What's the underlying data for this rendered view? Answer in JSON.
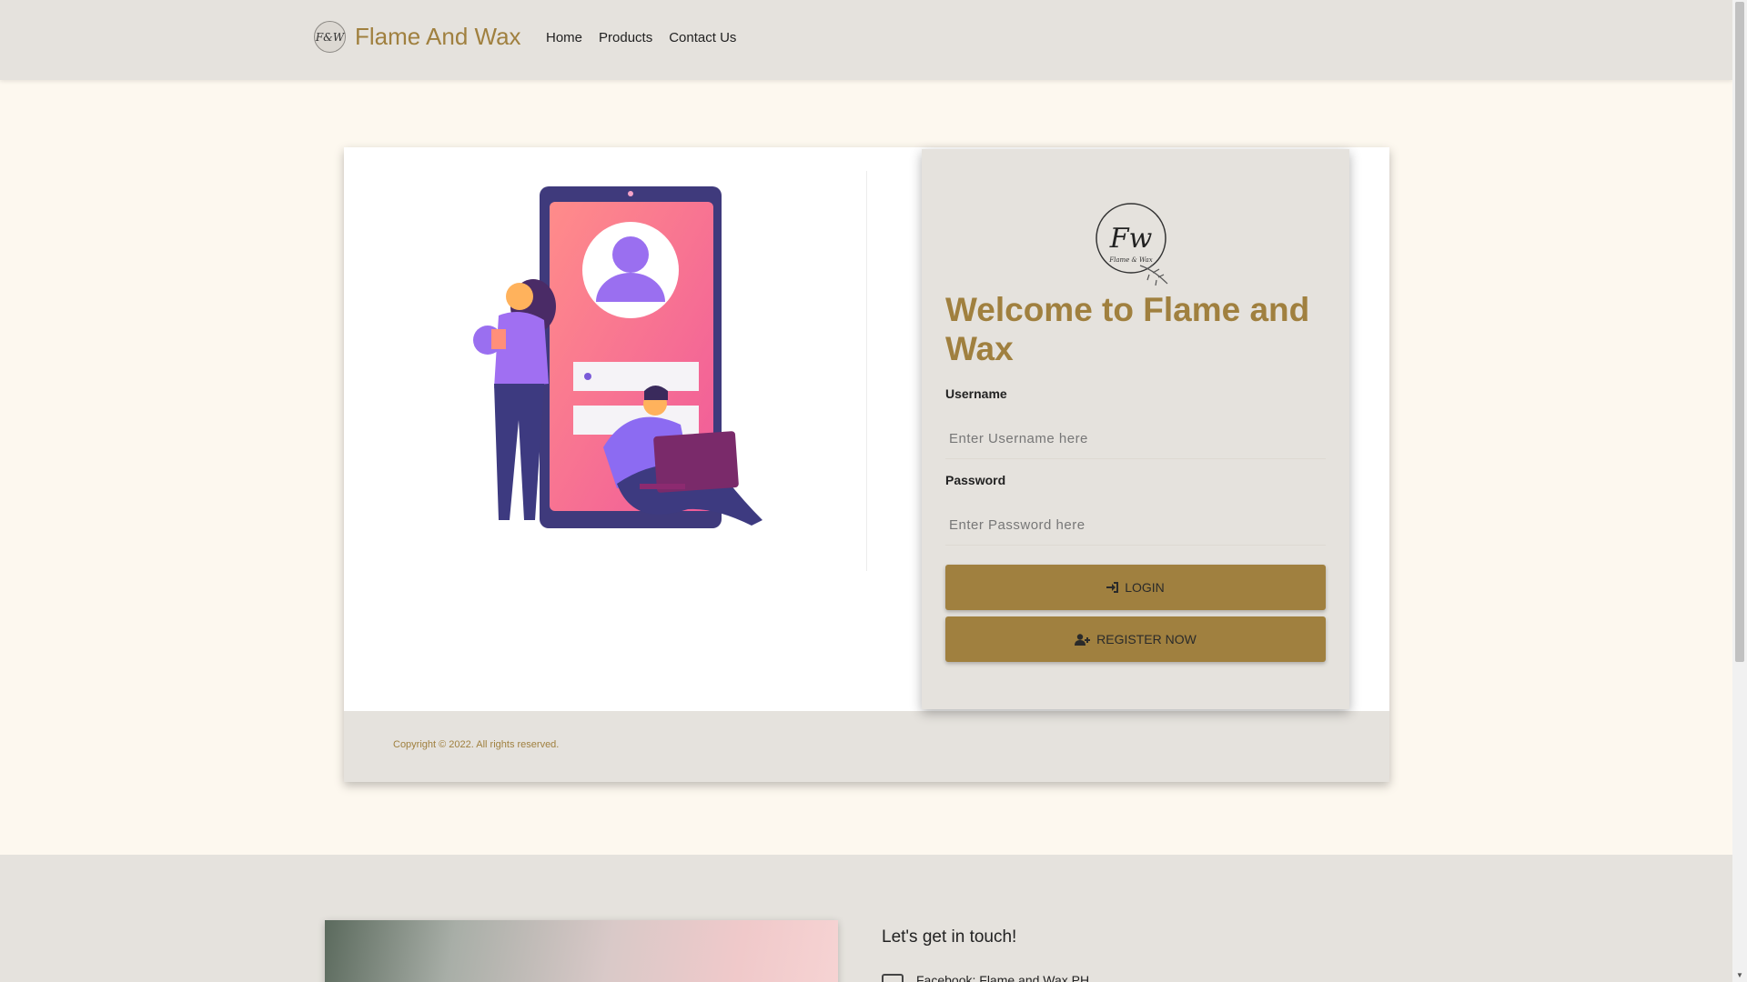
{
  "navbar": {
    "brand_logo_text": "F&W",
    "brand_name": "Flame And Wax",
    "links": [
      "Home",
      "Products",
      "Contact Us"
    ]
  },
  "login": {
    "heading": "Welcome to Flame and Wax",
    "username_label": "Username",
    "username_placeholder": "Enter Username here",
    "password_label": "Password",
    "password_placeholder": "Enter Password here",
    "login_button": "LOGIN",
    "register_button": "REGISTER NOW",
    "logo_caption": "Flame & Wax"
  },
  "footer": {
    "copyright": "Copyright © 2022. All rights reserved."
  },
  "contact": {
    "heading": "Let's get in touch!",
    "line1": "Facebook: Flame and Wax PH"
  },
  "colors": {
    "accent": "#a0803f",
    "navbar_bg": "#e5e2dd",
    "page_bg": "#fdf8ef"
  }
}
